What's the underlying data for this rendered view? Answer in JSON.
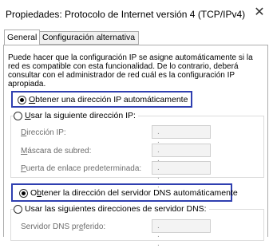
{
  "window": {
    "title": "Propiedades: Protocolo de Internet versión 4 (TCP/IPv4)",
    "close_glyph": "✕"
  },
  "tabs": [
    {
      "label": "General",
      "selected": true
    },
    {
      "label": "Configuración alternativa",
      "selected": false
    }
  ],
  "description_lines": [
    "Puede hacer que la configuración IP se asigne automáticamente si la",
    "red es compatible con esta funcionalidad. De lo contrario, deberá",
    "consultar con el administrador de red cuál es la configuración IP",
    "apropiada."
  ],
  "ip": {
    "auto_option": {
      "prefix": "",
      "mnemonic": "O",
      "rest": "btener una dirección IP automáticamente",
      "selected": true
    },
    "manual_option": {
      "prefix": "",
      "mnemonic": "U",
      "rest": "sar la siguiente dirección IP:",
      "selected": false
    },
    "fields": [
      {
        "mnemonic": "D",
        "rest": "irección IP:",
        "value": ". . ."
      },
      {
        "mnemonic": "M",
        "rest": "áscara de subred:",
        "value": ". . ."
      },
      {
        "mnemonic": "P",
        "rest": "uerta de enlace predeterminada:",
        "value": ". . ."
      }
    ]
  },
  "dns": {
    "auto_option": {
      "prefix": "O",
      "mnemonic": "b",
      "rest": "tener la dirección del servidor DNS automáticamente",
      "selected": true
    },
    "manual_option": {
      "prefix": "Usar las siguientes direcciones de servidor DNS:",
      "mnemonic": "",
      "rest": "",
      "selected": false
    },
    "preferred_server": {
      "prefix": "Servidor DNS pr",
      "mnemonic": "e",
      "rest": "ferido:",
      "value": ". . ."
    }
  },
  "colors": {
    "highlight_border": "#2f3fb0"
  }
}
